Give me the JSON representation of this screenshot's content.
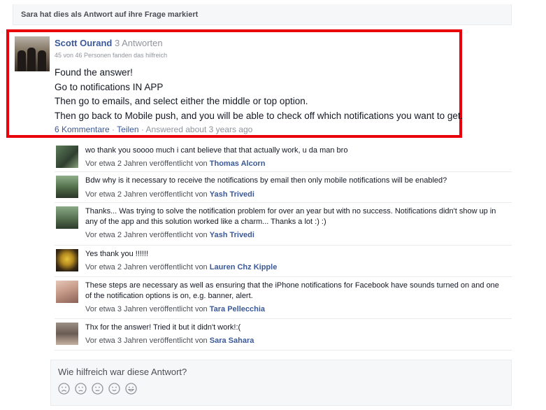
{
  "top_bar": {
    "text": "Sara hat dies als Antwort auf ihre Frage markiert"
  },
  "answer": {
    "author": "Scott Ourand",
    "answer_count": "3 Antworten",
    "helpful": "45 von 46 Personen fanden das hilfreich",
    "lines": [
      "Found the answer!",
      "Go to notifications IN APP",
      "Then go to emails, and select either the middle or top option.",
      "Then go back to Mobile push, and you will be able to check off which notifications you want to get."
    ],
    "comments_link": "6 Kommentare",
    "share_link": "Teilen",
    "answered": "Answered about 3 years ago",
    "separator": "·"
  },
  "comments": [
    {
      "text": "wo thank you soooo much i cant believe that that actually work, u da man bro",
      "meta": "Vor etwa 2 Jahren veröffentlicht von",
      "user": "Thomas Alcorn"
    },
    {
      "text": "Bdw why is it necessary to receive the notifications by email then only mobile notifications will be enabled?",
      "meta": "Vor etwa 2 Jahren veröffentlicht von",
      "user": "Yash Trivedi"
    },
    {
      "text": "Thanks... Was trying to solve the notification problem for over an year but with no success. Notifications didn't show up in any of the app and this solution worked like a charm... Thanks a lot :) :)",
      "meta": "Vor etwa 2 Jahren veröffentlicht von",
      "user": "Yash Trivedi"
    },
    {
      "text": "Yes thank you !!!!!!",
      "meta": "Vor etwa 2 Jahren veröffentlicht von",
      "user": "Lauren Chz Kipple"
    },
    {
      "text": "These steps are necessary as well as ensuring that the iPhone notifications for Facebook have sounds turned on and one of the notification options is on, e.g. banner, alert.",
      "meta": "Vor etwa 3 Jahren veröffentlicht von",
      "user": "Tara Pellecchia"
    },
    {
      "text": "Thx for the answer! Tried it but it didn't work!:(",
      "meta": "Vor etwa 3 Jahren veröffentlicht von",
      "user": "Sara Sahara"
    }
  ],
  "feedback": {
    "question": "Wie hilfreich war diese Antwort?",
    "faces": [
      "very-sad-face-icon",
      "sad-face-icon",
      "neutral-face-icon",
      "smile-face-icon",
      "happy-face-icon"
    ]
  },
  "colors": {
    "link": "#3b5998",
    "highlight_border": "#e8000b",
    "muted": "#90949c"
  }
}
